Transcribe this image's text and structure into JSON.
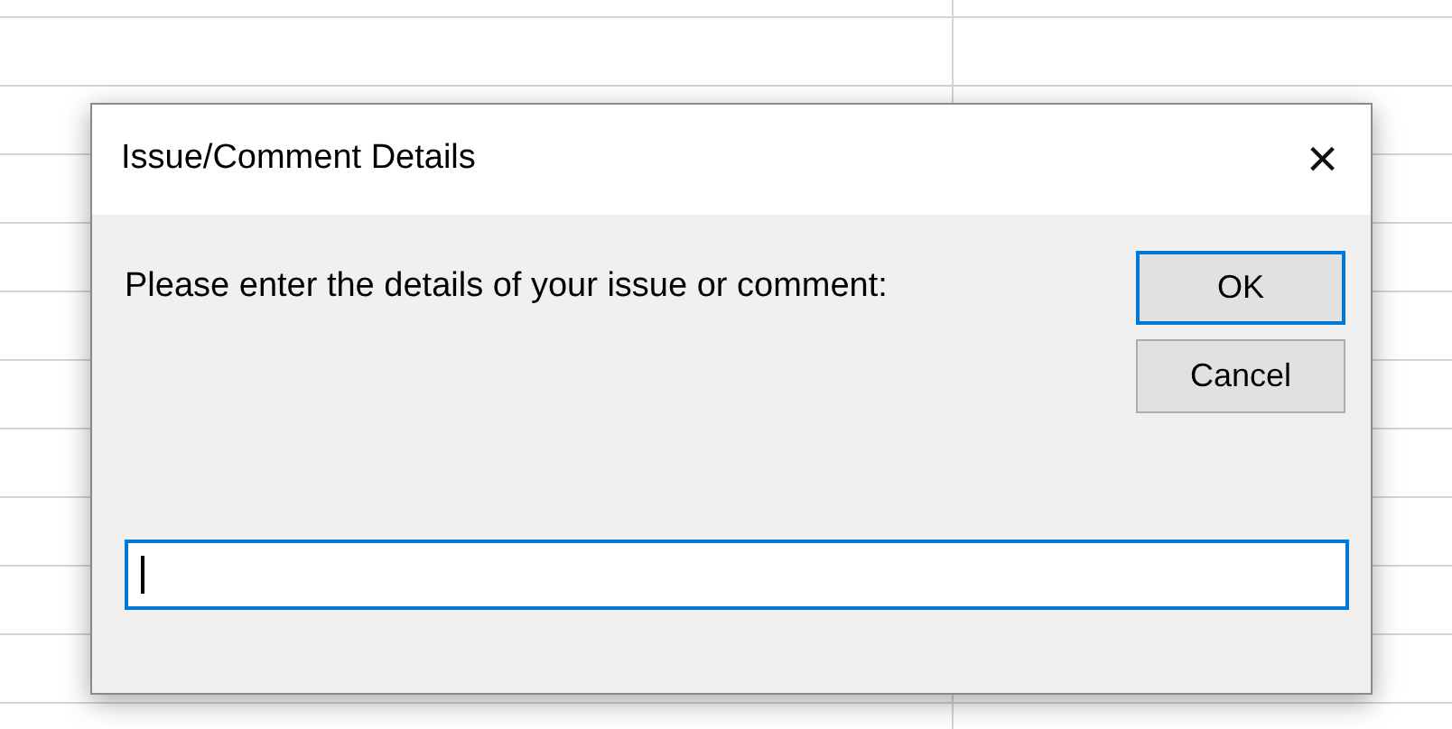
{
  "window": {
    "title": "Issue/Comment Details",
    "close": "×"
  },
  "prompt": "Please enter the details of your issue or comment:",
  "buttons": [
    {
      "label": "OK",
      "default": true
    },
    {
      "label": "Cancel",
      "default": false
    }
  ],
  "input": {
    "focused": true
  }
}
